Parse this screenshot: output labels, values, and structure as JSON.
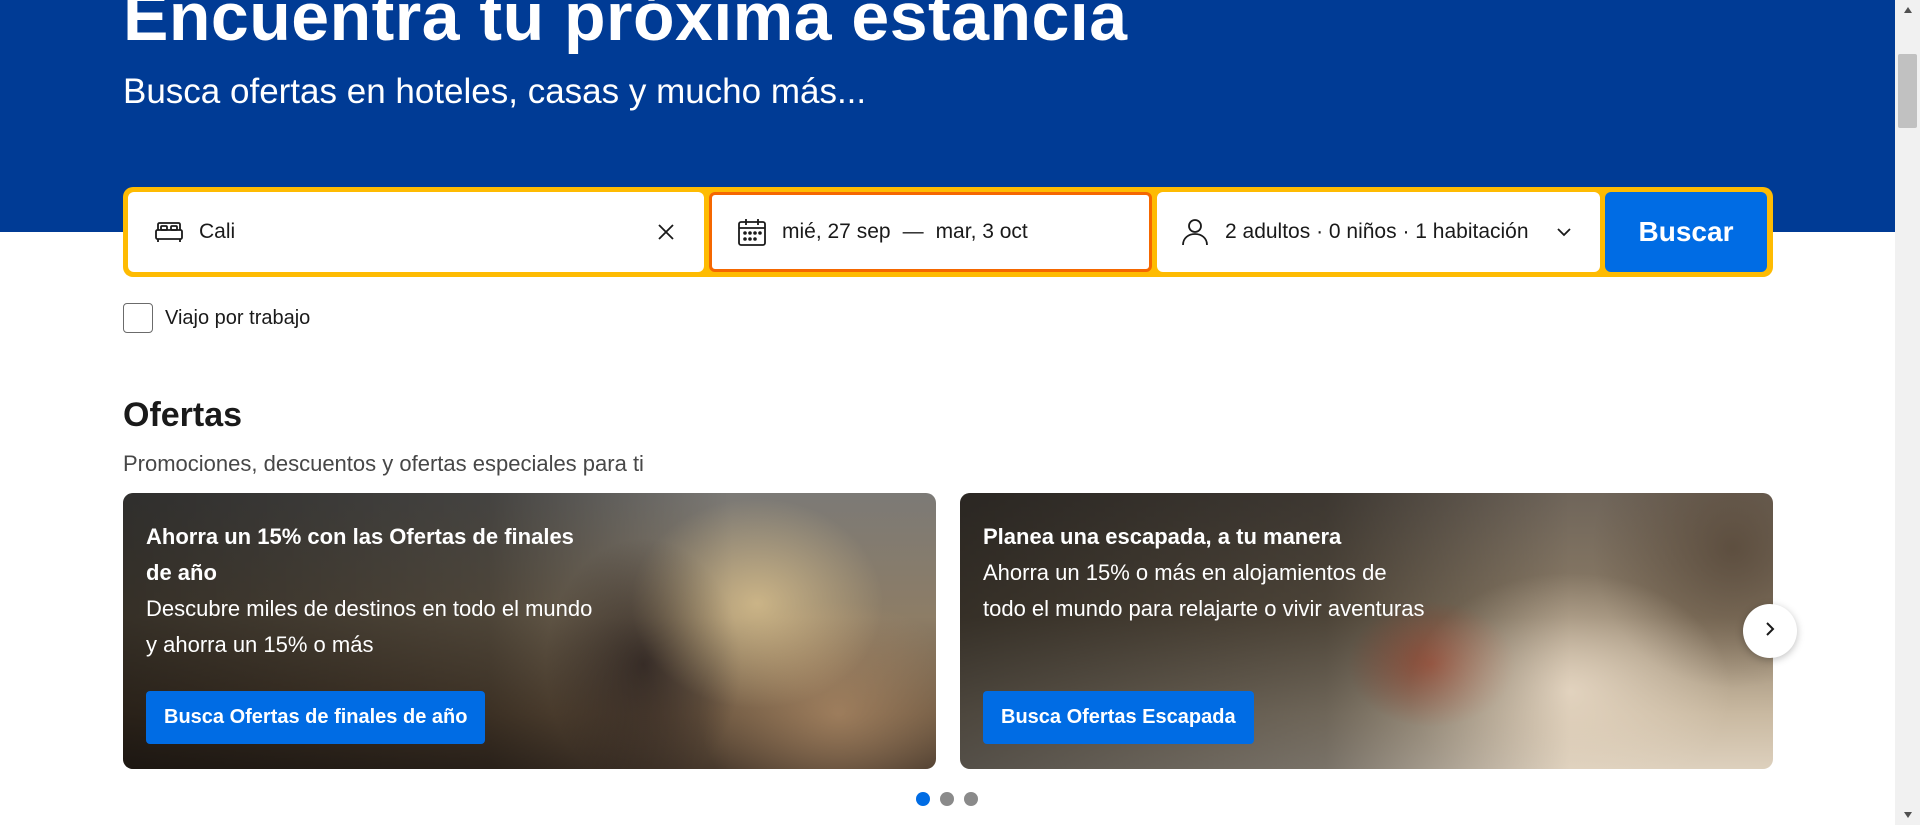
{
  "hero": {
    "title": "Encuentra tu próxima estancia",
    "subtitle": "Busca ofertas en hoteles, casas y mucho más..."
  },
  "search": {
    "destination_value": "Cali",
    "check_in": "mié, 27 sep",
    "separator": "—",
    "check_out": "mar, 3 oct",
    "occupancy": "2 adultos · 0 niños · 1 habitación",
    "search_label": "Buscar",
    "business_trip_label": "Viajo por trabajo",
    "business_trip_checked": false
  },
  "offers": {
    "title": "Ofertas",
    "subtitle": "Promociones, descuentos y ofertas especiales para ti",
    "cards": [
      {
        "title": "Ahorra un 15% con las Ofertas de finales de año",
        "description": "Descubre miles de destinos en todo el mundo y ahorra un 15% o más",
        "button": "Busca Ofertas de finales de año"
      },
      {
        "title": "Planea una escapada, a tu manera",
        "description": "Ahorra un 15% o más en alojamientos de todo el mundo para relajarte o vivir aventuras",
        "button": "Busca Ofertas Escapada"
      }
    ],
    "carousel_active_index": 0,
    "carousel_count": 3
  },
  "colors": {
    "brand_blue": "#003b95",
    "search_border": "#febb02",
    "active_field_border": "#f56700",
    "action_blue": "#006ce4"
  },
  "icons": [
    "bed-icon",
    "close-icon",
    "calendar-icon",
    "person-icon",
    "chevron-down-icon",
    "chevron-right-icon"
  ]
}
